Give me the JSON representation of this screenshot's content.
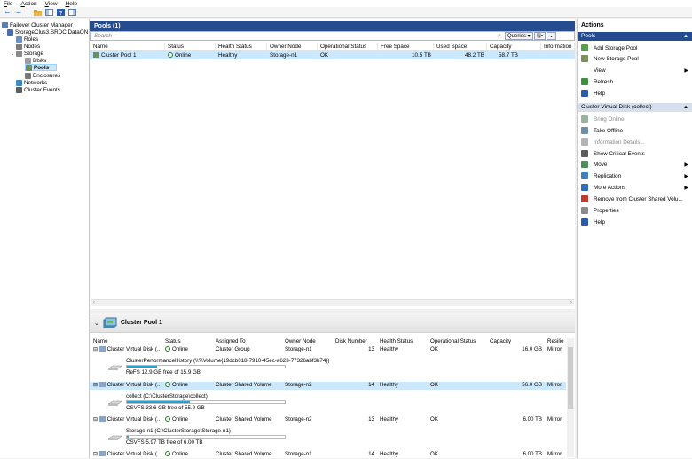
{
  "menu": [
    "File",
    "Action",
    "View",
    "Help"
  ],
  "tree": [
    {
      "label": "Failover Cluster Manager",
      "indent": 0,
      "color": "#5b7fb6"
    },
    {
      "label": "StorageClus3.SRDC.DataON",
      "indent": 1,
      "color": "#4a6ea8"
    },
    {
      "label": "Roles",
      "indent": 2,
      "color": "#6b8fc3"
    },
    {
      "label": "Nodes",
      "indent": 2,
      "color": "#7d7d7d"
    },
    {
      "label": "Storage",
      "indent": 2,
      "color": "#8a8a8a"
    },
    {
      "label": "Disks",
      "indent": 3,
      "color": "#9e9e9e"
    },
    {
      "label": "Pools",
      "indent": 3,
      "color": "#6e8f5a"
    },
    {
      "label": "Enclosures",
      "indent": 3,
      "color": "#7a7a7a"
    },
    {
      "label": "Networks",
      "indent": 2,
      "color": "#3c88c4"
    },
    {
      "label": "Cluster Events",
      "indent": 2,
      "color": "#5c5c5c"
    }
  ],
  "pools": {
    "title": "Pools (1)",
    "search_placeholder": "Search",
    "queries_label": "Queries",
    "columns": [
      "Name",
      "Status",
      "Health Status",
      "Owner Node",
      "Operational Status",
      "Free Space",
      "Used Space",
      "Capacity",
      "Information"
    ],
    "row": {
      "name": "Cluster Pool 1",
      "status": "Online",
      "health": "Healthy",
      "owner": "Storage-n1",
      "op": "OK",
      "free": "10.5 TB",
      "used": "48.2 TB",
      "capacity": "58.7 TB",
      "info": ""
    }
  },
  "detail": {
    "title": "Cluster Pool 1",
    "columns": [
      "Name",
      "Status",
      "Assigned To",
      "Owner Node",
      "Disk Number",
      "Health Status",
      "Operational Status",
      "Capacity",
      "Resilie"
    ],
    "disks": [
      {
        "name": "Cluster Virtual Disk (...",
        "status": "Online",
        "assigned": "Cluster Group",
        "owner": "Storage-n1",
        "disknum": "13",
        "health": "Healthy",
        "op": "OK",
        "capacity": "16.0 GB",
        "res": "Mirror,",
        "vol": "ClusterPerformanceHistory (\\\\?\\Volume{19dcb018-7910-45ec-a623-77326abf3b74})",
        "free": "ReFS 12.9 GB free of 15.9 GB",
        "pct": 0.19,
        "selected": false
      },
      {
        "name": "Cluster Virtual Disk (...",
        "status": "Online",
        "assigned": "Cluster Shared Volume",
        "owner": "Storage-n2",
        "disknum": "14",
        "health": "Healthy",
        "op": "OK",
        "capacity": "56.0 GB",
        "res": "Mirror,",
        "vol": "collect (C:\\ClusterStorage\\collect)",
        "free": "CSVFS 33.6 GB free of 55.9 GB",
        "pct": 0.4,
        "selected": true
      },
      {
        "name": "Cluster Virtual Disk (...",
        "status": "Online",
        "assigned": "Cluster Shared Volume",
        "owner": "Storage-n2",
        "disknum": "13",
        "health": "Healthy",
        "op": "OK",
        "capacity": "6.00 TB",
        "res": "Mirror,",
        "vol": "Storage-n1 (C:\\ClusterStorage\\Storage-n1)",
        "free": "CSVFS 5.97 TB free of 6.00 TB",
        "pct": 0.005,
        "selected": false
      },
      {
        "name": "Cluster Virtual Disk (...",
        "status": "Online",
        "assigned": "Cluster Shared Volume",
        "owner": "Storage-n1",
        "disknum": "14",
        "health": "Healthy",
        "op": "OK",
        "capacity": "6.00 TB",
        "res": "Mirror,",
        "vol": "",
        "free": "",
        "pct": 0,
        "selected": false
      }
    ]
  },
  "actions": {
    "title": "Actions",
    "section1": "Pools",
    "items1": [
      {
        "label": "Add Storage Pool",
        "icon": "add-pool-icon",
        "color": "#5b9b4b",
        "sub": false
      },
      {
        "label": "New Storage Pool",
        "icon": "new-pool-icon",
        "color": "#7a8f5a",
        "sub": false
      },
      {
        "label": "View",
        "icon": "",
        "color": "",
        "sub": true
      },
      {
        "label": "Refresh",
        "icon": "refresh-icon",
        "color": "#3d8f3d",
        "sub": false
      },
      {
        "label": "Help",
        "icon": "help-icon",
        "color": "#2b5aa8",
        "sub": false
      }
    ],
    "section2": "Cluster Virtual Disk (collect)",
    "items2": [
      {
        "label": "Bring Online",
        "icon": "bring-online-icon",
        "color": "#9ab3a0",
        "sub": false,
        "disabled": true
      },
      {
        "label": "Take Offline",
        "icon": "take-offline-icon",
        "color": "#6f8fa6",
        "sub": false,
        "disabled": false
      },
      {
        "label": "Information Details...",
        "icon": "info-details-icon",
        "color": "#b5b5b5",
        "sub": false,
        "disabled": true
      },
      {
        "label": "Show Critical Events",
        "icon": "critical-events-icon",
        "color": "#5c5c5c",
        "sub": false,
        "disabled": false
      },
      {
        "label": "Move",
        "icon": "move-icon",
        "color": "#4d8a5d",
        "sub": true,
        "disabled": false
      },
      {
        "label": "Replication",
        "icon": "replication-icon",
        "color": "#3e7fbf",
        "sub": true,
        "disabled": false
      },
      {
        "label": "More Actions",
        "icon": "more-actions-icon",
        "color": "#2e6fb8",
        "sub": true,
        "disabled": false
      },
      {
        "label": "Remove from Cluster Shared Volu...",
        "icon": "remove-csv-icon",
        "color": "#c0392b",
        "sub": false,
        "disabled": false
      },
      {
        "label": "Properties",
        "icon": "properties-icon",
        "color": "#8a8a8a",
        "sub": false,
        "disabled": false
      },
      {
        "label": "Help",
        "icon": "help-icon",
        "color": "#2b5aa8",
        "sub": false,
        "disabled": false
      }
    ]
  }
}
